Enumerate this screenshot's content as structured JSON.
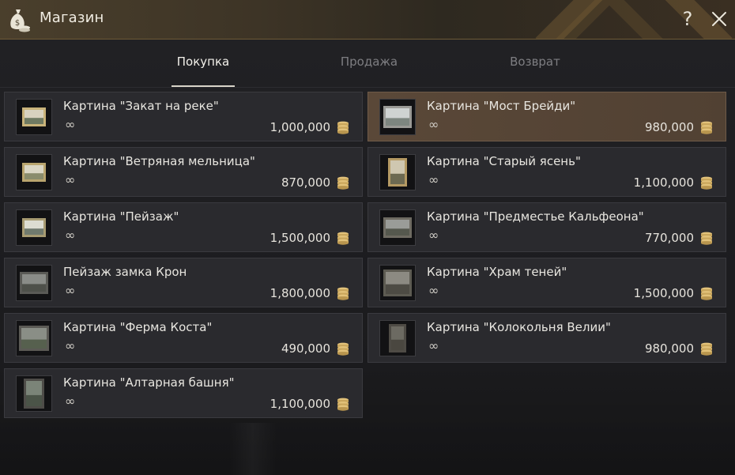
{
  "window": {
    "title": "Магазин",
    "help_glyph": "?",
    "icon": "money-bag-icon"
  },
  "tabs": [
    {
      "label": "Покупка",
      "active": true
    },
    {
      "label": "Продажа",
      "active": false
    },
    {
      "label": "Возврат",
      "active": false
    }
  ],
  "items": [
    {
      "name": "Картина \"Закат на реке\"",
      "stock": "∞",
      "price": "1,000,000",
      "selected": false,
      "thumb": "painting-sunset-river-icon"
    },
    {
      "name": "Картина \"Мост Брейди\"",
      "stock": "∞",
      "price": "980,000",
      "selected": true,
      "thumb": "painting-bridge-icon"
    },
    {
      "name": "Картина \"Ветряная мельница\"",
      "stock": "∞",
      "price": "870,000",
      "selected": false,
      "thumb": "painting-windmill-icon"
    },
    {
      "name": "Картина \"Старый ясень\"",
      "stock": "∞",
      "price": "1,100,000",
      "selected": false,
      "thumb": "painting-old-ash-icon"
    },
    {
      "name": "Картина \"Пейзаж\"",
      "stock": "∞",
      "price": "1,500,000",
      "selected": false,
      "thumb": "painting-landscape-icon"
    },
    {
      "name": "Картина \"Предместье Кальфеона\"",
      "stock": "∞",
      "price": "770,000",
      "selected": false,
      "thumb": "painting-calpheon-suburb-icon"
    },
    {
      "name": "Пейзаж замка Крон",
      "stock": "∞",
      "price": "1,800,000",
      "selected": false,
      "thumb": "painting-kron-castle-icon"
    },
    {
      "name": "Картина \"Храм теней\"",
      "stock": "∞",
      "price": "1,500,000",
      "selected": false,
      "thumb": "painting-shadow-temple-icon"
    },
    {
      "name": "Картина \"Ферма Коста\"",
      "stock": "∞",
      "price": "490,000",
      "selected": false,
      "thumb": "painting-costa-farm-icon"
    },
    {
      "name": "Картина \"Колокольня Велии\"",
      "stock": "∞",
      "price": "980,000",
      "selected": false,
      "thumb": "painting-velia-bell-tower-icon"
    },
    {
      "name": "Картина \"Алтарная башня\"",
      "stock": "∞",
      "price": "1,100,000",
      "selected": false,
      "thumb": "painting-altar-tower-icon"
    }
  ],
  "colors": {
    "accent_gold": "#d4b36a",
    "selected_card": "#5a4838",
    "card": "#2a2a2e"
  }
}
